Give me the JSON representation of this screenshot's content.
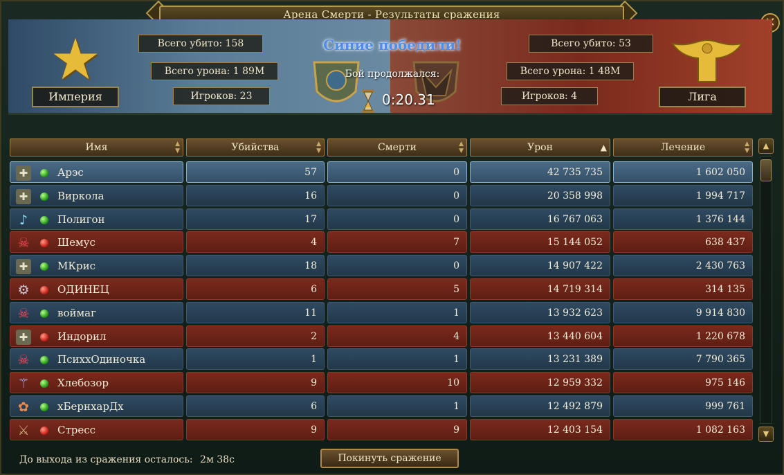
{
  "window": {
    "title": "Арена Смерти - Результаты сражения",
    "close": "✕"
  },
  "header": {
    "left": {
      "team": "Империя",
      "killed": "Всего убито: 158",
      "damage": "Всего урона: 1 89M",
      "players": "Игроков: 23"
    },
    "right": {
      "team": "Лига",
      "killed": "Всего убито: 53",
      "damage": "Всего урона: 1 48M",
      "players": "Игроков: 4"
    },
    "victory": "Синие победили!",
    "lasted_label": "Бой продолжался:",
    "time": "0:20.31"
  },
  "columns": [
    "Имя",
    "Убийства",
    "Смерти",
    "Урон",
    "Лечение"
  ],
  "rows": [
    {
      "icon": "shield-cross-icon",
      "status": "green",
      "team": "blue",
      "name": "Арэс",
      "kills": "57",
      "deaths": "0",
      "damage": "42 735 735",
      "healing": "1 602 050",
      "selected": true
    },
    {
      "icon": "shield-cross-icon",
      "status": "green",
      "team": "blue",
      "name": "Виркола",
      "kills": "16",
      "deaths": "0",
      "damage": "20 358 998",
      "healing": "1 994 717"
    },
    {
      "icon": "lute-icon",
      "status": "green",
      "team": "blue",
      "name": "Полигон",
      "kills": "17",
      "deaths": "0",
      "damage": "16 767 063",
      "healing": "1 376 144"
    },
    {
      "icon": "skull-icon",
      "status": "red",
      "team": "red",
      "name": "Шемус",
      "kills": "4",
      "deaths": "7",
      "damage": "15 144 052",
      "healing": "638 437"
    },
    {
      "icon": "shield-cross-icon",
      "status": "green",
      "team": "blue",
      "name": "МКрис",
      "kills": "18",
      "deaths": "0",
      "damage": "14 907 422",
      "healing": "2 430 763"
    },
    {
      "icon": "gear-icon",
      "status": "red",
      "team": "red",
      "name": "ОДИНЕЦ",
      "kills": "6",
      "deaths": "5",
      "damage": "14 719 314",
      "healing": "314 135"
    },
    {
      "icon": "skull-icon",
      "status": "green",
      "team": "blue",
      "name": "воймаг",
      "kills": "11",
      "deaths": "1",
      "damage": "13 932 623",
      "healing": "9 914 830"
    },
    {
      "icon": "shield-cross-icon",
      "status": "red",
      "team": "red",
      "name": "Индорил",
      "kills": "2",
      "deaths": "4",
      "damage": "13 440 604",
      "healing": "1 220 678"
    },
    {
      "icon": "skull-icon",
      "status": "green",
      "team": "blue",
      "name": "ПсихxОдиночка",
      "kills": "1",
      "deaths": "1",
      "damage": "13 231 389",
      "healing": "7 790 365"
    },
    {
      "icon": "staff-icon",
      "status": "green",
      "team": "red",
      "name": "Хлебозор",
      "kills": "9",
      "deaths": "10",
      "damage": "12 959 332",
      "healing": "975 146"
    },
    {
      "icon": "paw-icon",
      "status": "green",
      "team": "blue",
      "name": "хБернхарДх",
      "kills": "6",
      "deaths": "1",
      "damage": "12 492 879",
      "healing": "999 761"
    },
    {
      "icon": "sword-icon",
      "status": "red",
      "team": "red",
      "name": "Стресс",
      "kills": "9",
      "deaths": "9",
      "damage": "12 403 154",
      "healing": "1 082 163"
    }
  ],
  "footer": {
    "countdown_label": "До выхода из сражения осталось:",
    "countdown": "2м 38с",
    "leave_button": "Покинуть сражение"
  },
  "colors": {
    "blue_row": "#2f4a62",
    "red_row": "#7a2a1c",
    "gold": "#c9a24c",
    "victory_blue": "#4f8ee8"
  }
}
